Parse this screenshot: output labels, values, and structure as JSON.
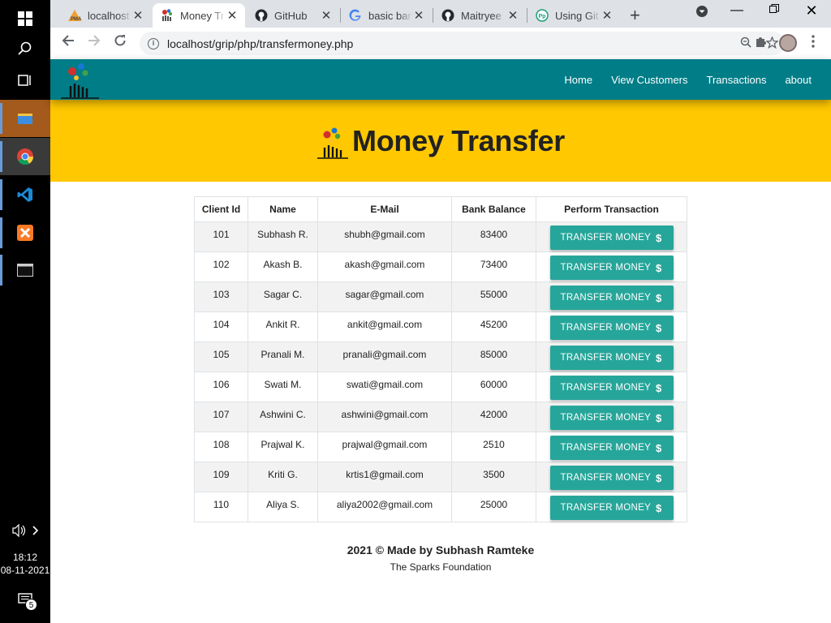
{
  "taskbar": {
    "items": [
      "windows-start",
      "search",
      "task-view",
      "file-explorer",
      "chrome",
      "vscode",
      "xampp",
      "terminal"
    ],
    "time": "18:12",
    "date": "08-11-2021",
    "notifications": "5"
  },
  "browser": {
    "tabs": [
      {
        "title": "localhost",
        "icon": "pma-icon"
      },
      {
        "title": "Money Tr",
        "icon": "sparks-logo-icon"
      },
      {
        "title": "GitHub",
        "icon": "github-icon"
      },
      {
        "title": "basic ban",
        "icon": "google-icon"
      },
      {
        "title": "Maitryee",
        "icon": "github-icon"
      },
      {
        "title": "Using Git",
        "icon": "pp-icon"
      }
    ],
    "url": "localhost/grip/php/transfermoney.php"
  },
  "nav": {
    "links": [
      "Home",
      "View Customers",
      "Transactions",
      "about"
    ]
  },
  "hero": {
    "title": "Money Transfer"
  },
  "table": {
    "headers": [
      "Client Id",
      "Name",
      "E-Mail",
      "Bank Balance",
      "Perform Transaction"
    ],
    "button_label": "TRANSFER MONEY",
    "button_icon": "$",
    "rows": [
      {
        "id": "101",
        "name": "Subhash R.",
        "email": "shubh@gmail.com",
        "balance": "83400"
      },
      {
        "id": "102",
        "name": "Akash B.",
        "email": "akash@gmail.com",
        "balance": "73400"
      },
      {
        "id": "103",
        "name": "Sagar C.",
        "email": "sagar@gmail.com",
        "balance": "55000"
      },
      {
        "id": "104",
        "name": "Ankit R.",
        "email": "ankit@gmail.com",
        "balance": "45200"
      },
      {
        "id": "105",
        "name": "Pranali M.",
        "email": "pranali@gmail.com",
        "balance": "85000"
      },
      {
        "id": "106",
        "name": "Swati M.",
        "email": "swati@gmail.com",
        "balance": "60000"
      },
      {
        "id": "107",
        "name": "Ashwini C.",
        "email": "ashwini@gmail.com",
        "balance": "42000"
      },
      {
        "id": "108",
        "name": "Prajwal K.",
        "email": "prajwal@gmail.com",
        "balance": "2510"
      },
      {
        "id": "109",
        "name": "Kriti G.",
        "email": "krtis1@gmail.com",
        "balance": "3500"
      },
      {
        "id": "110",
        "name": "Aliya S.",
        "email": "aliya2002@gmail.com",
        "balance": "25000"
      }
    ]
  },
  "footer": {
    "line1": "2021 © Made by Subhash Ramteke",
    "line2": "The Sparks Foundation"
  },
  "colors": {
    "navbar": "#007d87",
    "hero": "#ffc800",
    "button": "#26a69a"
  }
}
